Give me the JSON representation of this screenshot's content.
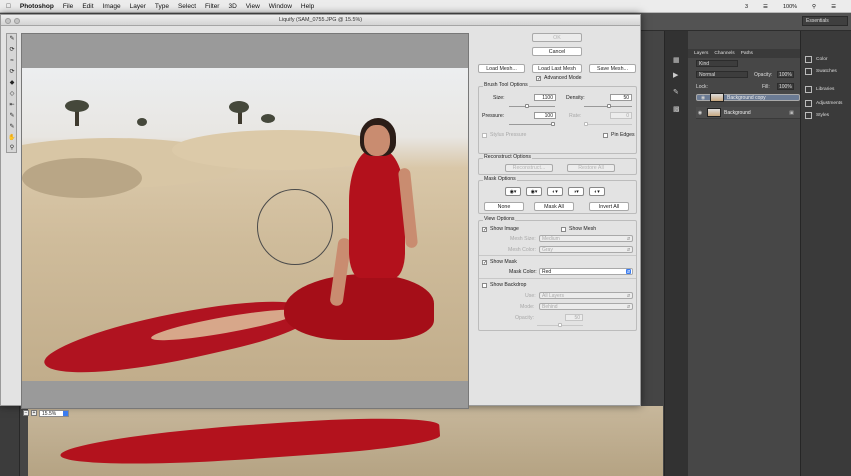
{
  "menubar": {
    "apple": "",
    "app": "Photoshop",
    "items": [
      "File",
      "Edit",
      "Image",
      "Layer",
      "Type",
      "Select",
      "Filter",
      "3D",
      "View",
      "Window",
      "Help"
    ],
    "status_text": "3",
    "battery": "100%",
    "clock_icon": "clock-icon"
  },
  "workspace": {
    "essentials": "Essentials"
  },
  "layers_panel": {
    "tabs": [
      "Layers",
      "Channels",
      "Paths"
    ],
    "kind": "Kind",
    "blend": "Normal",
    "opacity_label": "Opacity:",
    "opacity": "100%",
    "lock_label": "Lock:",
    "fill_label": "Fill:",
    "fill": "100%",
    "layers": [
      {
        "name": "Background copy",
        "selected": true
      },
      {
        "name": "Background",
        "selected": false,
        "locked": true
      }
    ]
  },
  "right_panel": {
    "items": [
      "Color",
      "Swatches",
      "Libraries",
      "Adjustments",
      "Styles"
    ]
  },
  "dialog": {
    "title": "Liquify (SAM_0755.JPG @ 15.5%)",
    "zoom": "15.5%",
    "ok": "OK",
    "cancel": "Cancel",
    "load_mesh": "Load Mesh...",
    "load_last_mesh": "Load Last Mesh",
    "save_mesh": "Save Mesh...",
    "advanced_mode": "Advanced Mode",
    "brush": {
      "title": "Brush Tool Options",
      "size_label": "Size:",
      "size": "1100",
      "density_label": "Density:",
      "density": "50",
      "pressure_label": "Pressure:",
      "pressure": "100",
      "rate_label": "Rate:",
      "rate": "0",
      "stylus_pressure": "Stylus Pressure",
      "pin_edges": "Pin Edges"
    },
    "reconstruct": {
      "title": "Reconstruct Options",
      "reconstruct_btn": "Reconstruct...",
      "restore_all": "Restore All"
    },
    "mask": {
      "title": "Mask Options",
      "none": "None",
      "mask_all": "Mask All",
      "invert_all": "Invert All"
    },
    "view": {
      "title": "View Options",
      "show_image": "Show Image",
      "show_mesh": "Show Mesh",
      "mesh_size_label": "Mesh Size:",
      "mesh_size": "Medium",
      "mesh_color_label": "Mesh Color:",
      "mesh_color": "Gray",
      "show_mask": "Show Mask",
      "mask_color_label": "Mask Color:",
      "mask_color": "Red",
      "show_backdrop": "Show Backdrop",
      "use_label": "Use:",
      "use": "All Layers",
      "mode_label": "Mode:",
      "mode": "Behind",
      "opacity_label": "Opacity:",
      "opacity": "50"
    }
  }
}
